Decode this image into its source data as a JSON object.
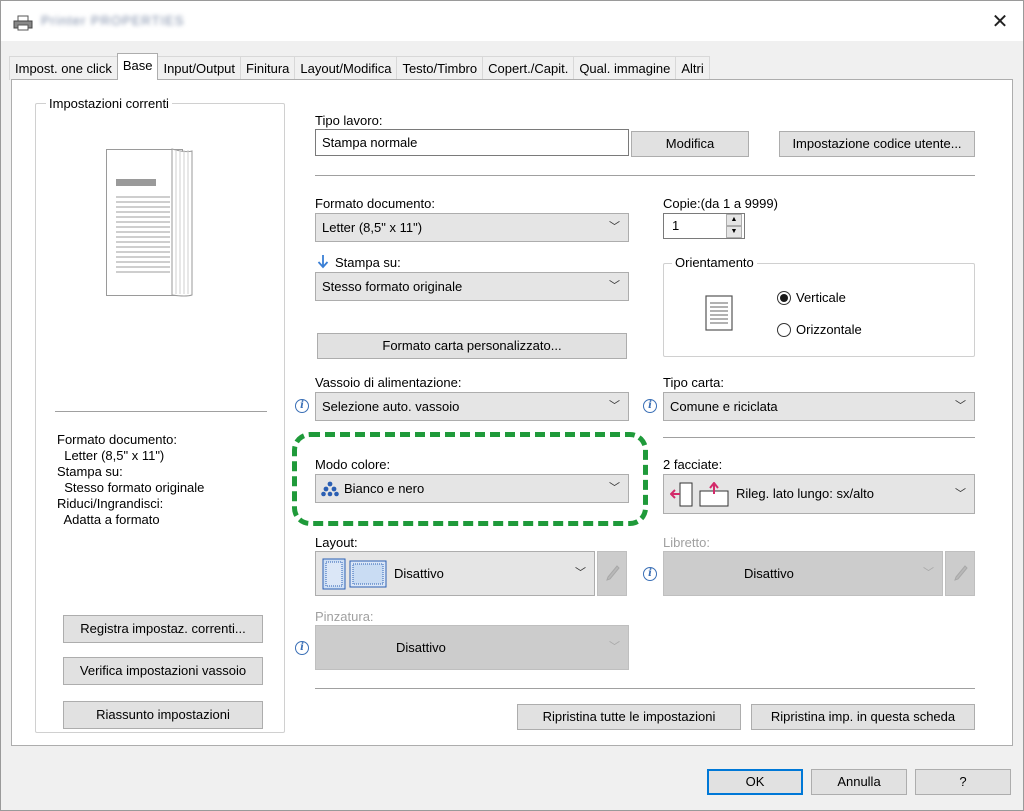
{
  "titlebar": {
    "title": "Printer PROPERTIES",
    "close_glyph": "✕",
    "icons": {
      "app": "printer-icon",
      "close": "close-icon"
    }
  },
  "tabs": [
    {
      "label": "Impost. one click"
    },
    {
      "label": "Base"
    },
    {
      "label": "Input/Output"
    },
    {
      "label": "Finitura"
    },
    {
      "label": "Layout/Modifica"
    },
    {
      "label": "Testo/Timbro"
    },
    {
      "label": "Copert./Capit."
    },
    {
      "label": "Qual. immagine"
    },
    {
      "label": "Altri"
    }
  ],
  "active_tab": "Base",
  "left_panel": {
    "group_title": "Impostazioni correnti",
    "summary": [
      "Formato documento:",
      "  Letter (8,5\" x 11\")",
      "Stampa su:",
      "  Stesso formato originale",
      "Riduci/Ingrandisci:",
      "  Adatta a formato"
    ],
    "buttons": {
      "register": "Registra impostaz. correnti...",
      "check_tray": "Verifica impostazioni vassoio",
      "summary": "Riassunto impostazioni"
    }
  },
  "job": {
    "label": "Tipo lavoro:",
    "value": "Stampa normale",
    "modify_button": "Modifica",
    "user_code_button": "Impostazione codice utente..."
  },
  "document": {
    "format_label": "Formato documento:",
    "format_value": "Letter (8,5\" x 11\")",
    "print_on_label": "Stampa su:",
    "print_on_value": "Stesso formato originale",
    "custom_paper_button": "Formato carta personalizzato..."
  },
  "copies": {
    "label": "Copie:(da 1 a 9999)",
    "value": "1"
  },
  "orientation": {
    "group_title": "Orientamento",
    "portrait": "Verticale",
    "landscape": "Orizzontale",
    "selected": "Verticale"
  },
  "tray": {
    "label": "Vassoio di alimentazione:",
    "value": "Selezione auto. vassoio"
  },
  "paper_type": {
    "label": "Tipo carta:",
    "value": "Comune e riciclata"
  },
  "color_mode": {
    "label": "Modo colore:",
    "value": "Bianco e nero"
  },
  "duplex": {
    "label": "2 facciate:",
    "value": "Rileg. lato lungo: sx/alto"
  },
  "layout": {
    "label": "Layout:",
    "value": "Disattivo"
  },
  "booklet": {
    "label": "Libretto:",
    "value": "Disattivo"
  },
  "staple": {
    "label": "Pinzatura:",
    "value": "Disattivo"
  },
  "reset_buttons": {
    "all": "Ripristina tutte le impostazioni",
    "tab": "Ripristina imp. in questa scheda"
  },
  "footer": {
    "ok": "OK",
    "cancel": "Annulla",
    "help": "?"
  },
  "colors": {
    "highlight_frame": "#1f9a3a",
    "disabled_combo": "#cccccc",
    "info_icon": "#3a6fb6"
  }
}
